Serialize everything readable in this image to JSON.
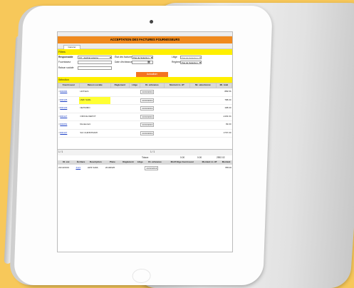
{
  "page_title": "ACCEPTATION DES FACTURES FOURNISSEURS",
  "tab_label": "Générer",
  "filters": {
    "section_label": "Filtres",
    "responsable_label": "Responsable",
    "responsable_value": "CX : decliné externe",
    "etat_factures_label": "État des factures",
    "etat_factures_value": "Pas de Sélection",
    "litige_label": "Litige",
    "litige_value": "Pas de Sélection",
    "fournisseur_label": "Fournisseur",
    "fournisseur_value": "",
    "date_echeance_label": "Date d'échéance",
    "reglement_label": "Règlement",
    "reglement_value": "Pas de Sélection",
    "raison_sociale_label": "Raison sociale",
    "raison_sociale_value": "",
    "actualiser_label": "Actualiser"
  },
  "selection_label": "Sélection",
  "invoice_table": {
    "headers": [
      "Fournisseur",
      "Raison sociale",
      "Règlement",
      "Litige",
      "Dt. échéance",
      "Montant LL HT",
      "Mt. sélectionné",
      "Mt. total"
    ],
    "rows": [
      {
        "code": "000084",
        "raison": "HOTELS",
        "date": "23/10/2019",
        "total": "889.56"
      },
      {
        "code": "000125",
        "raison": "HWF SARL",
        "date": "23/10/2019",
        "total": "788.00"
      },
      {
        "code": "000129",
        "raison": "NETIMMO",
        "date": "23/10/2019",
        "total": "198.00"
      },
      {
        "code": "000127",
        "raison": "OFFICE DEPOT",
        "date": "23/10/2019",
        "total": "-1163.34"
      },
      {
        "code": "000052",
        "raison": "Restaurant",
        "date": "23/10/2019",
        "total": "99.00"
      },
      {
        "code": "000107",
        "raison": "SCI CHRISTIMATI",
        "date": "23/10/2019",
        "total": "1797.00"
      }
    ]
  },
  "pager": {
    "left": "1 / 1",
    "center": "1 / 1"
  },
  "totals": {
    "label": "Totaux",
    "v1": "0.00",
    "v2": "0.00",
    "v3": "2592.02"
  },
  "detail_table": {
    "headers": [
      "Dt. écr.",
      "Écriture",
      "Description",
      "Pièce",
      "Règlement",
      "Litige",
      "Dt. échéance",
      "Motif litige fournisseur",
      "Montant LL HT",
      "Montant"
    ],
    "rows": [
      {
        "dt": "23/10/2019",
        "ecriture": "4121",
        "desc": "HWF SARL",
        "piece": "20190925",
        "date": "23/10/2019",
        "montant": "788.00"
      }
    ]
  }
}
